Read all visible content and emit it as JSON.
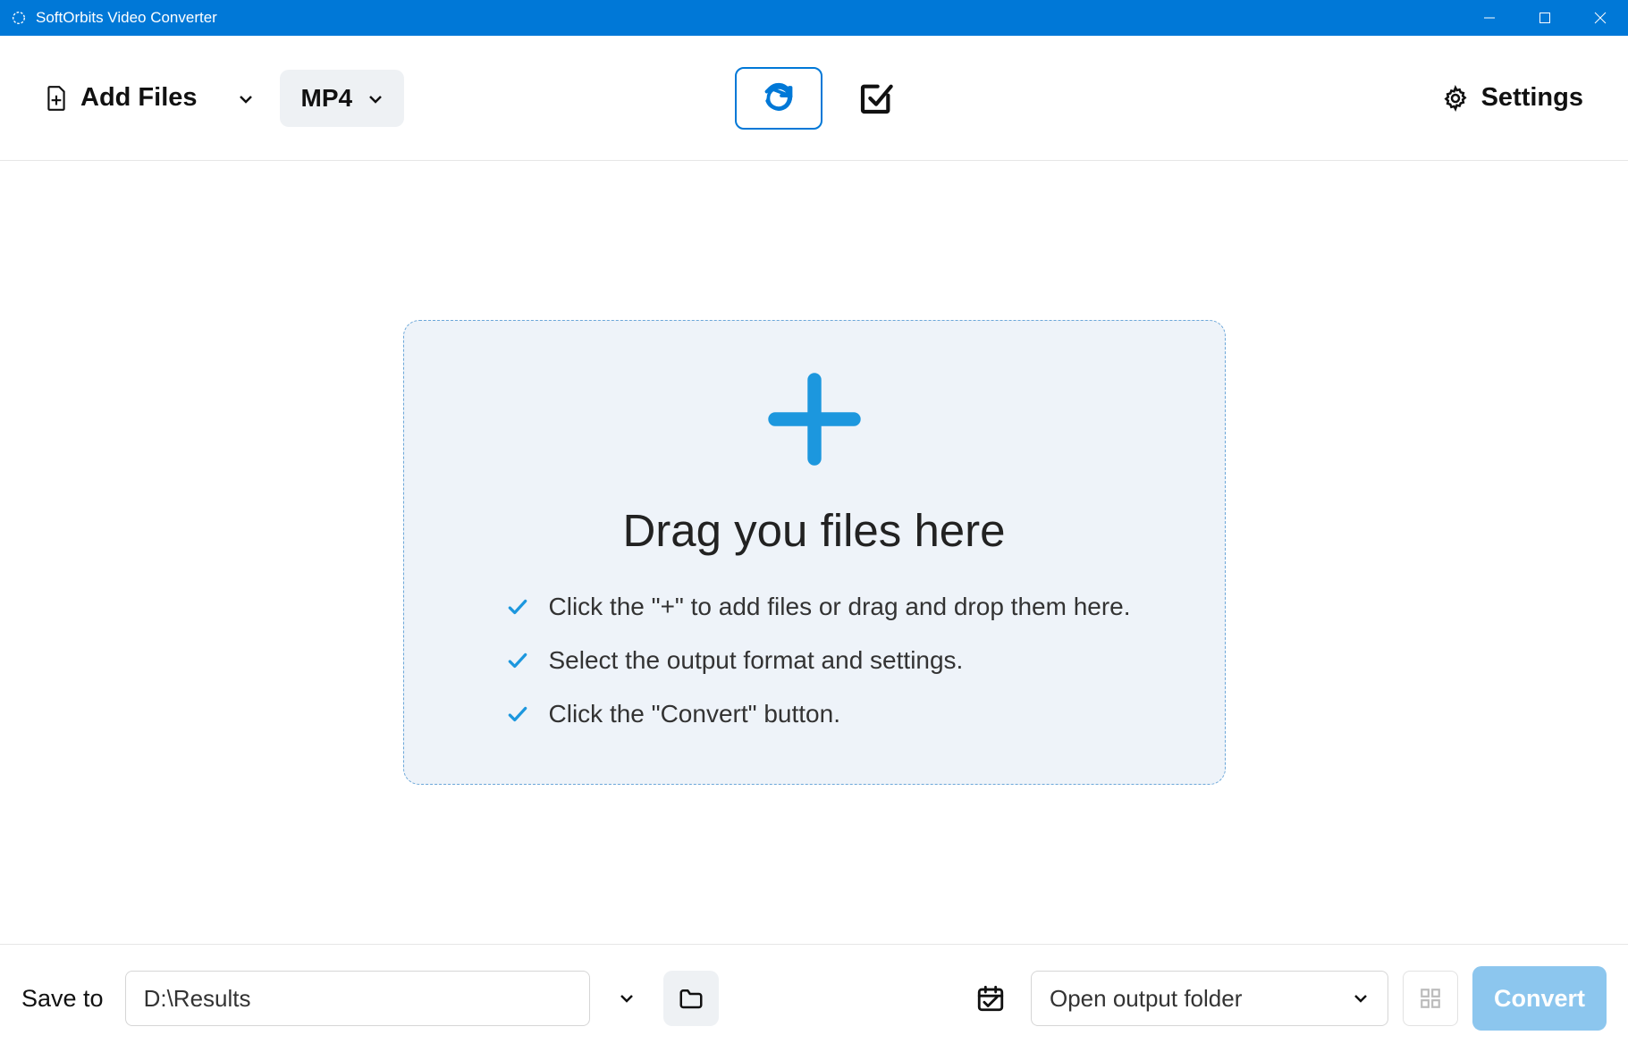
{
  "titlebar": {
    "title": "SoftOrbits Video Converter"
  },
  "toolbar": {
    "add_files_label": "Add Files",
    "format_label": "MP4",
    "settings_label": "Settings"
  },
  "dropzone": {
    "title": "Drag you files here",
    "instructions": [
      "Click the \"+\" to add files or drag and drop them here.",
      "Select the output format and settings.",
      "Click the \"Convert\" button."
    ]
  },
  "bottom": {
    "save_to_label": "Save to",
    "output_path": "D:\\Results",
    "open_output_label": "Open output folder",
    "convert_label": "Convert"
  }
}
